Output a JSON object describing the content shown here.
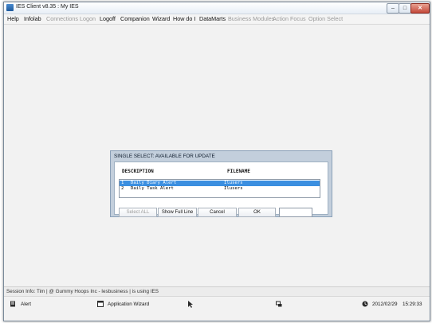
{
  "window": {
    "title": "IES Client v8.35 : My IES",
    "close_glyph": "✕",
    "min_glyph": "–",
    "max_glyph": "□"
  },
  "menu": [
    {
      "label": "Help",
      "enabled": true
    },
    {
      "label": "Infolab",
      "enabled": true
    },
    {
      "label": "Connections",
      "enabled": false
    },
    {
      "label": "Logon",
      "enabled": false
    },
    {
      "label": "Logoff",
      "enabled": true
    },
    {
      "label": "Companion",
      "enabled": true
    },
    {
      "label": "Wizard",
      "enabled": true
    },
    {
      "label": "How do I",
      "enabled": true
    },
    {
      "label": "DataMarts",
      "enabled": true
    },
    {
      "label": "Business Modules",
      "enabled": false
    },
    {
      "label": "Action Focus",
      "enabled": false
    },
    {
      "label": "Option Select",
      "enabled": false
    }
  ],
  "dialog": {
    "title": "SINGLE SELECT: AVAILABLE FOR UPDATE",
    "col_description": "DESCRIPTION",
    "col_filename": "FILENAME",
    "rows": [
      {
        "num": "1",
        "description": "Daily Diary Alert",
        "filename": "Ilusers",
        "selected": true
      },
      {
        "num": "2",
        "description": "Daily Task Alert",
        "filename": "Ilusers",
        "selected": false
      }
    ],
    "buttons": {
      "select_all": "Select ALL",
      "show_full_line": "Show Full Line",
      "cancel": "Cancel",
      "ok": "OK"
    },
    "search_value": ""
  },
  "session_info": "Session Info: Tim | @ Gummy Hoops Inc  - Iesbusiness | is using IES",
  "taskbar": {
    "alert_label": "Alert",
    "app_wizard_label": "Application Wizard",
    "date": "2012/02/29",
    "time": "15:29:33"
  },
  "icons": {
    "alert": "alert-icon",
    "wizard": "application-wizard-icon",
    "cursor": "pointer-icon",
    "network": "network-icon",
    "clock": "clock-icon"
  },
  "colors": {
    "selection": "#3b8fe0",
    "dialog_frame": "#c3cfdc"
  }
}
